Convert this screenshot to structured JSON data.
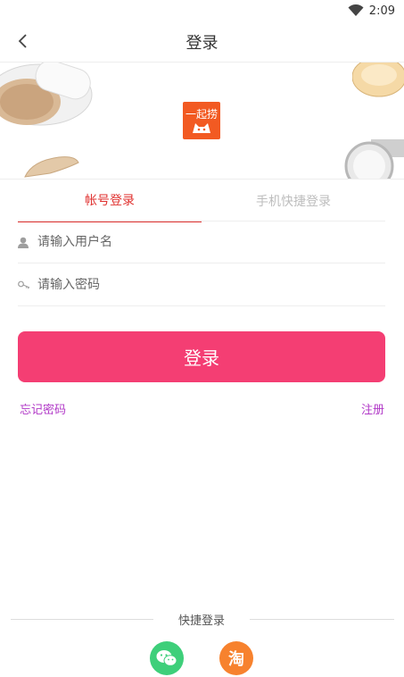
{
  "status_bar": {
    "time": "2:09"
  },
  "header": {
    "title": "登录"
  },
  "brand": {
    "logo_text": "一起捞"
  },
  "tabs": [
    {
      "label": "帐号登录",
      "active": true
    },
    {
      "label": "手机快捷登录",
      "active": false
    }
  ],
  "form": {
    "username_placeholder": "请输入用户名",
    "password_placeholder": "请输入密码",
    "login_label": "登录"
  },
  "links": {
    "forgot": "忘记密码",
    "register": "注册"
  },
  "quick_login": {
    "label": "快捷登录",
    "wechat_icon": "wechat-icon",
    "taobao_icon_text": "淘"
  },
  "colors": {
    "accent": "#e0312f",
    "button": "#f43e73",
    "link": "#b138c7",
    "wechat": "#3ecf7a",
    "taobao": "#f7822e"
  }
}
